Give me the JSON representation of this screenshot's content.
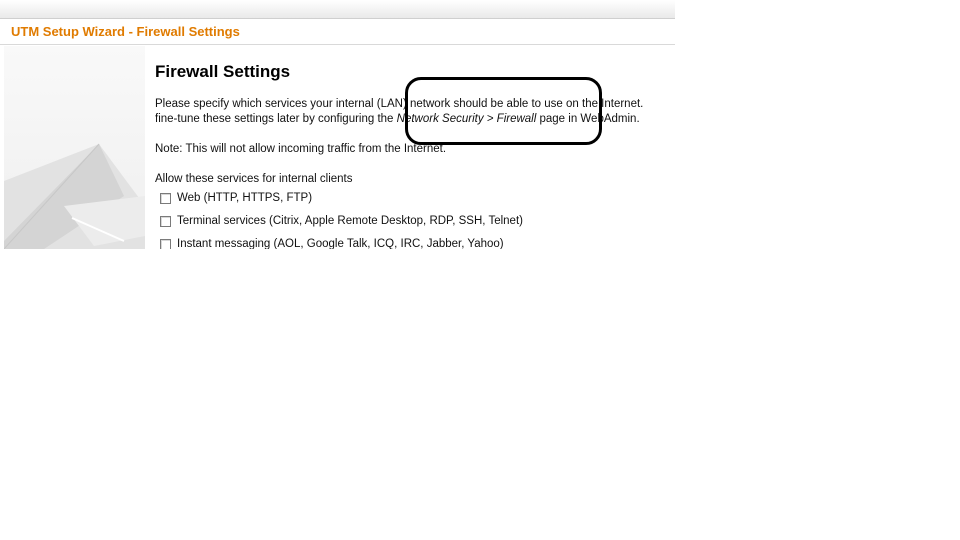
{
  "wizard": {
    "title": "UTM Setup Wizard - Firewall Settings"
  },
  "content": {
    "heading": "Firewall Settings",
    "intro_line1": "Please specify which services your internal (LAN) network should be able to use on the Internet.",
    "intro_line2_prefix": "fine-tune these settings later by configuring the ",
    "intro_line2_link": "Network Security > Firewall",
    "intro_line2_suffix": " page in WebAdmin.",
    "note": "Note: This will not allow incoming traffic from the Internet.",
    "allow_label": "Allow these services for internal clients",
    "services": [
      {
        "label": "Web (HTTP, HTTPS, FTP)",
        "checked": false
      },
      {
        "label": "Terminal services (Citrix, Apple Remote Desktop, RDP, SSH, Telnet)",
        "checked": false
      },
      {
        "label": "Instant messaging (AOL, Google Talk, ICQ, IRC, Jabber, Yahoo)",
        "checked": false
      }
    ]
  },
  "colors": {
    "title_orange": "#e07b00",
    "annotation": "#000000"
  }
}
